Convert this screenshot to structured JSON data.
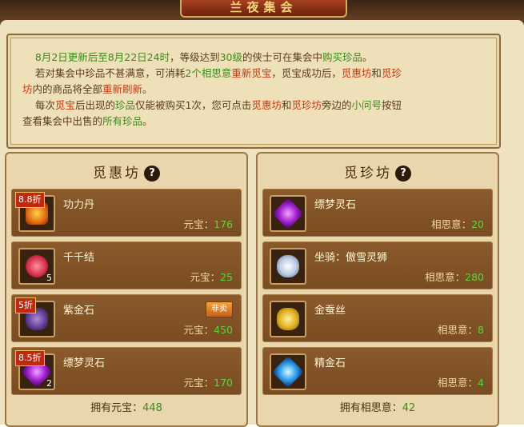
{
  "header": {
    "title": "兰夜集会"
  },
  "notice": {
    "line1_date_a": "8月2日更新后至8月22日24时",
    "line1_mid": "，等级达到",
    "line1_level": "30级",
    "line1_end": "的侠士可在集会中",
    "line1_action": "购买珍品",
    "line1_tail": "。",
    "line2_a": "若对集会中珍品不甚满意，可消耗",
    "line2_cost": "2个相思意",
    "line2_b": "重新觅宝",
    "line2_c": "，觅宝成功后，",
    "line2_shop1": "觅惠坊",
    "line2_and": "和",
    "line2_shop2": "觅珍",
    "line3_shop2b": "坊",
    "line3_a": "内的商品将全部",
    "line3_b": "重新刷新",
    "line3_tail": "。",
    "line4_a": "每次",
    "line4_b": "觅宝",
    "line4_c": "后出现的",
    "line4_d": "珍品",
    "line4_e": "仅能被购买1次，您可点击",
    "line4_f": "觅惠坊",
    "line4_g": "和",
    "line4_h": "觅珍坊",
    "line4_i": "旁边的",
    "line4_j": "小问号",
    "line4_k": "按钮",
    "line5_a": "查看集会中出售的",
    "line5_b": "所有珍品",
    "line5_tail": "。"
  },
  "left_shop": {
    "title": "觅惠坊",
    "items": [
      {
        "name": "功力丹",
        "discount": "8.8折",
        "qty": "",
        "price_label": "元宝：",
        "price": "176",
        "hot": ""
      },
      {
        "name": "千千结",
        "discount": "",
        "qty": "5",
        "price_label": "元宝：",
        "price": "25",
        "hot": ""
      },
      {
        "name": "紫金石",
        "discount": "5折",
        "qty": "",
        "price_label": "元宝：",
        "price": "450",
        "hot": "非卖"
      },
      {
        "name": "缥梦灵石",
        "discount": "8.5折",
        "qty": "2",
        "price_label": "元宝：",
        "price": "170",
        "hot": ""
      }
    ],
    "owned_label": "拥有元宝：",
    "owned_value": "448"
  },
  "right_shop": {
    "title": "觅珍坊",
    "items": [
      {
        "name": "缥梦灵石",
        "price_label": "相思意：",
        "price": "20"
      },
      {
        "name": "坐骑：傲雪灵狮",
        "price_label": "相思意：",
        "price": "280"
      },
      {
        "name": "金蚕丝",
        "price_label": "相思意：",
        "price": "8"
      },
      {
        "name": "精金石",
        "price_label": "相思意：",
        "price": "4"
      }
    ],
    "owned_label": "拥有相思意：",
    "owned_value": "42"
  },
  "icons": [
    "help-icon",
    "pill-icon",
    "knot-icon",
    "stone-icon",
    "gem-icon",
    "lion-icon",
    "silk-icon",
    "crystal-icon"
  ],
  "colors": {
    "highlight_green": "#3d8a1c",
    "highlight_red": "#c03a12",
    "price_green": "#5fd23a"
  }
}
